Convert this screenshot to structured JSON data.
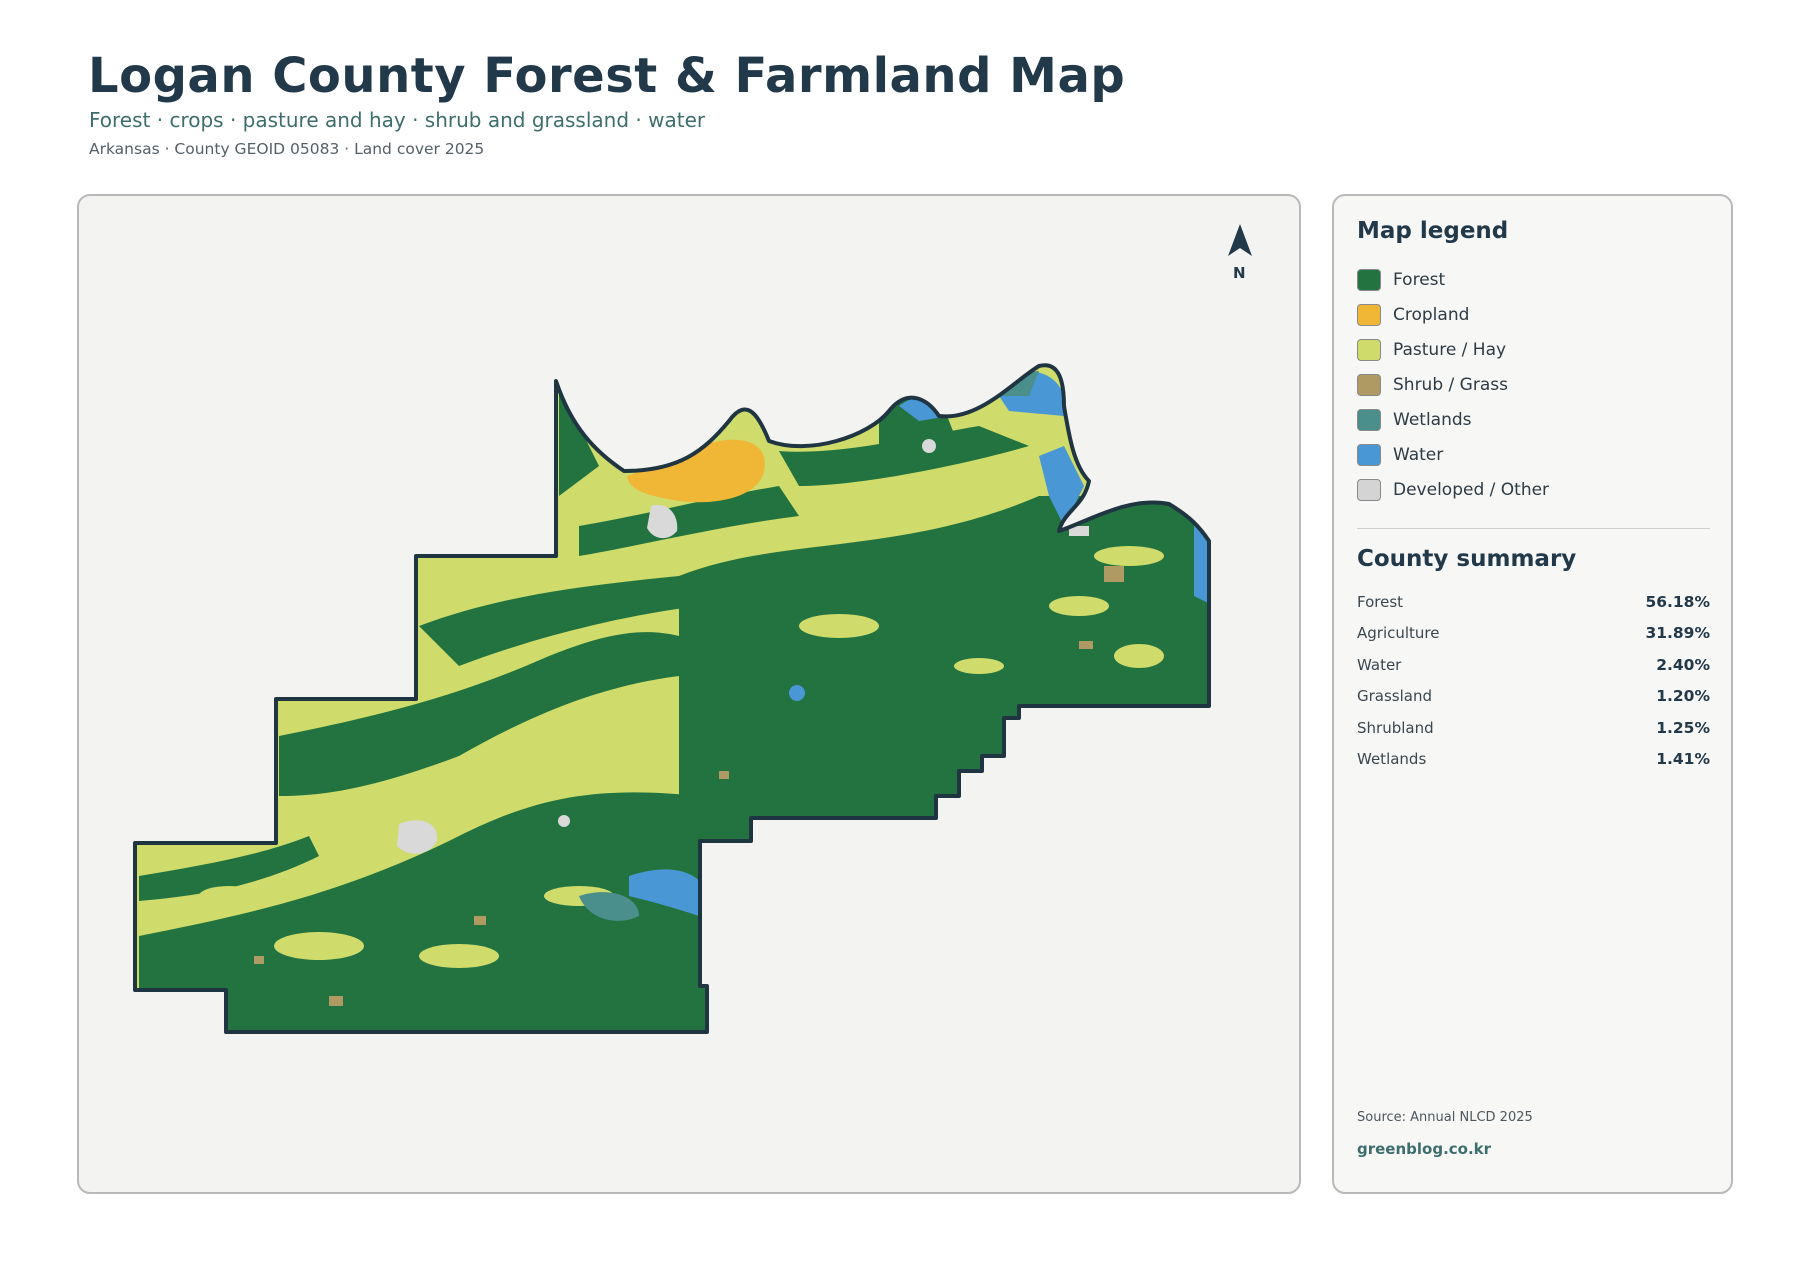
{
  "header": {
    "title": "Logan County Forest & Farmland Map",
    "subtitle": "Forest · crops · pasture and hay · shrub and grassland · water",
    "meta": "Arkansas · County GEOID 05083 · Land cover 2025"
  },
  "map": {
    "north_label": "N",
    "county_fill_colors": {
      "forest": "#22733f",
      "cropland": "#f0b636",
      "pasture": "#cfdc6b",
      "shrub": "#b09a63",
      "wetlands": "#4a8f8c",
      "water": "#4a97d6",
      "developed": "#d9d9d9",
      "outline": "#1f3542"
    }
  },
  "legend": {
    "title": "Map legend",
    "items": [
      {
        "label": "Forest",
        "color": "#22733f"
      },
      {
        "label": "Cropland",
        "color": "#f0b636"
      },
      {
        "label": "Pasture / Hay",
        "color": "#cfdc6b"
      },
      {
        "label": "Shrub / Grass",
        "color": "#b09a63"
      },
      {
        "label": "Wetlands",
        "color": "#4a8f8c"
      },
      {
        "label": "Water",
        "color": "#4a97d6"
      },
      {
        "label": "Developed / Other",
        "color": "#d4d4d4"
      }
    ]
  },
  "summary": {
    "title": "County summary",
    "rows": [
      {
        "name": "Forest",
        "value": "56.18%"
      },
      {
        "name": "Agriculture",
        "value": "31.89%"
      },
      {
        "name": "Water",
        "value": "2.40%"
      },
      {
        "name": "Grassland",
        "value": "1.20%"
      },
      {
        "name": "Shrubland",
        "value": "1.25%"
      },
      {
        "name": "Wetlands",
        "value": "1.41%"
      }
    ]
  },
  "footer": {
    "source": "Source: Annual NLCD 2025",
    "site": "greenblog.co.kr"
  }
}
